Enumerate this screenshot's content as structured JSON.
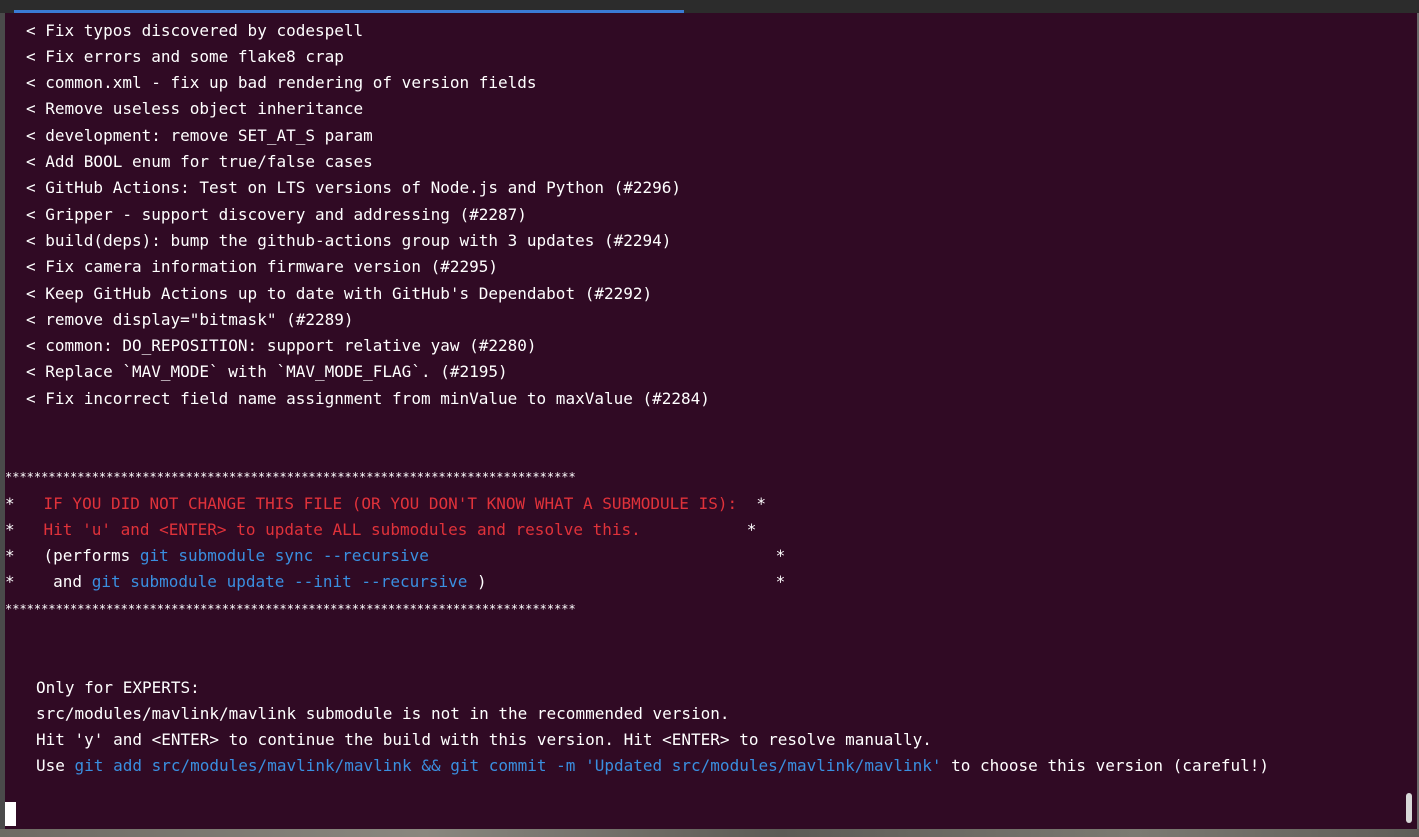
{
  "terminal": {
    "background": "#300a24",
    "log_lines": [
      "< Fix typos discovered by codespell",
      "< Fix errors and some flake8 crap",
      "< common.xml - fix up bad rendering of version fields",
      "< Remove useless object inheritance",
      "< development: remove SET_AT_S param",
      "< Add BOOL enum for true/false cases",
      "< GitHub Actions: Test on LTS versions of Node.js and Python (#2296)",
      "< Gripper - support discovery and addressing (#2287)",
      "< build(deps): bump the github-actions group with 3 updates (#2294)",
      "< Fix camera information firmware version (#2295)",
      "< Keep GitHub Actions up to date with GitHub's Dependabot (#2292)",
      "< remove display=\"bitmask\" (#2289)",
      "< common: DO_REPOSITION: support relative yaw (#2280)",
      "< Replace `MAV_MODE` with `MAV_MODE_FLAG`. (#2195)",
      "< Fix incorrect field name assignment from minValue to maxValue (#2284)"
    ],
    "banner": {
      "border": "*******************************************************************************",
      "line1_prefix": "*   ",
      "line1_text": "IF YOU DID NOT CHANGE THIS FILE (OR YOU DON'T KNOW WHAT A SUBMODULE IS):",
      "line1_suffix": "  *",
      "line2_prefix": "*   ",
      "line2_text": "Hit 'u' and <ENTER> to update ALL submodules and resolve this.",
      "line2_suffix": "           *",
      "line3_prefix": "*   (performs ",
      "line3_cmd": "git submodule sync --recursive",
      "line3_suffix": "                                    *",
      "line4_prefix": "*    and ",
      "line4_cmd": "git submodule update --init --recursive",
      "line4_suffix": " )                              *"
    },
    "experts": {
      "heading": "Only for EXPERTS:",
      "line1": "src/modules/mavlink/mavlink submodule is not in the recommended version.",
      "line2": "Hit 'y' and <ENTER> to continue the build with this version. Hit <ENTER> to resolve manually.",
      "line3_prefix": "Use ",
      "line3_cmd": "git add src/modules/mavlink/mavlink && git commit -m 'Updated src/modules/mavlink/mavlink'",
      "line3_suffix": " to choose this version (careful!)"
    },
    "colors": {
      "warning_red": "#e0323a",
      "command_blue": "#3a8fe0",
      "text_white": "#ffffff",
      "tab_indicator": "#3a7bd5"
    }
  }
}
